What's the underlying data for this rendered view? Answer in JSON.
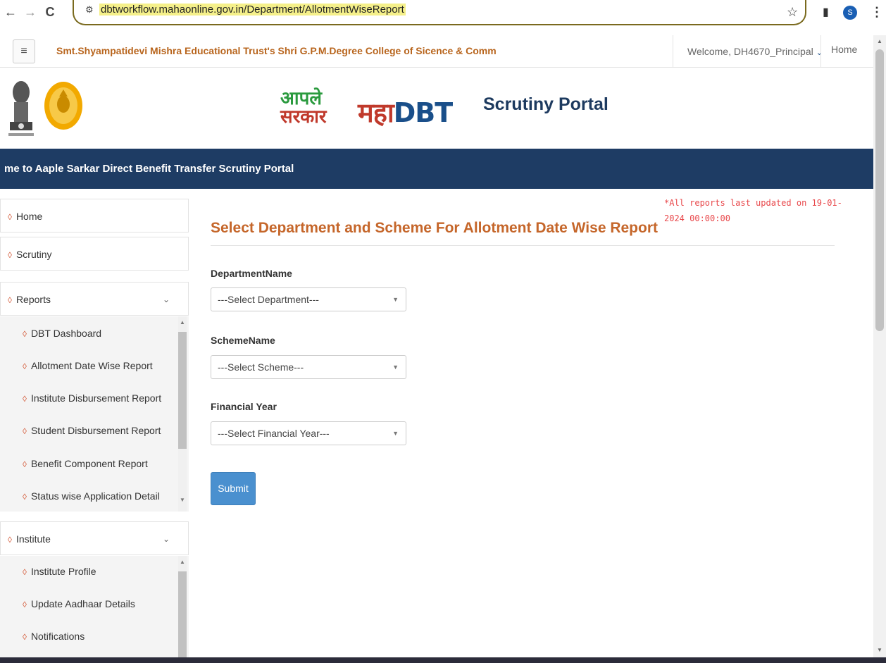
{
  "browser": {
    "back_icon": "←",
    "forward_icon": "→",
    "reload_icon": "C",
    "site_icon": "⚙",
    "url": "dbtworkflow.mahaonline.gov.in/Department/AllotmentWiseReport",
    "bookmark_icon": "☆",
    "sidepanel_icon": "▮",
    "profile_initial": "S",
    "menu_icon": "⋮"
  },
  "header": {
    "menu_icon": "≡",
    "college_name": "Smt.Shyampatidevi Mishra Educational Trust's Shri G.P.M.Degree College of Sicence & Comm",
    "welcome": "Welcome, DH4670_Principal",
    "welcome_chevron": "⌄",
    "home": "Home"
  },
  "branding": {
    "aaple_line1": "आपले",
    "aaple_line2": "सरकार",
    "maha": "महा",
    "dbt": "DBT",
    "portal_title": "Scrutiny Portal"
  },
  "marquee": "me to Aaple Sarkar Direct Benefit Transfer Scrutiny Portal",
  "sidebar": {
    "menu_glyph": "◊",
    "caret": "⌄",
    "home": "Home",
    "scrutiny": "Scrutiny",
    "reports": "Reports",
    "reports_items": [
      "DBT Dashboard",
      "Allotment Date Wise Report",
      "Institute Disbursement Report",
      "Student Disbursement Report",
      "Benefit Component Report",
      "Status wise Application Detail"
    ],
    "institute": "Institute",
    "institute_items": [
      "Institute Profile",
      "Update Aadhaar Details",
      "Notifications"
    ]
  },
  "main": {
    "notice": "*All reports last updated on 19-01-2024 00:00:00",
    "heading": "Select Department and Scheme For Allotment Date Wise Report",
    "department_label": "DepartmentName",
    "department_value": "---Select Department---",
    "scheme_label": "SchemeName",
    "scheme_value": "---Select Scheme---",
    "year_label": "Financial Year",
    "year_value": "---Select Financial Year---",
    "dropdown_arrow": "▼",
    "submit": "Submit"
  },
  "colors": {
    "accent_orange": "#c5662a",
    "navy": "#1e3c64",
    "notice_red": "#e8474a",
    "button_blue": "#4a90cf"
  }
}
